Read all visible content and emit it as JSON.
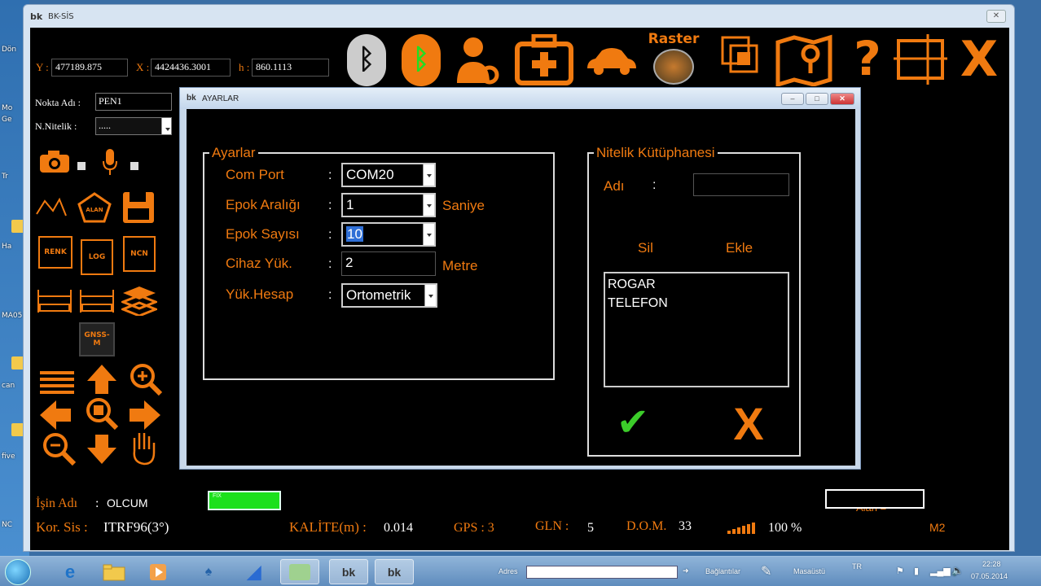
{
  "desktop": {
    "labels": [
      "Dön",
      "Mo",
      "Ge",
      "Tr",
      "Ha",
      "MA05",
      "can",
      "five",
      "NC"
    ]
  },
  "app": {
    "title": "BK-SİS",
    "close_glyph": "✕",
    "coords": {
      "y_label": "Y :",
      "y_value": "477189.875",
      "x_label": "X :",
      "x_value": "4424436.3001",
      "h_label": "h :",
      "h_value": "860.1113"
    },
    "toolbar": {
      "raster_label": "Raster",
      "help_glyph": "?",
      "exit_glyph": "X"
    },
    "left": {
      "nokta_label": "Nokta Adı :",
      "nokta_value": "PEN1",
      "nitelik_label": "N.Nitelik :",
      "nitelik_value": ".....",
      "renk_label": "RENK",
      "log_label": "LOG",
      "ncn_label": "NCN",
      "gnss_label": "GNSS-M",
      "alan_label": "ALAN"
    },
    "status": {
      "isin_label": "İşin Adı",
      "isin_colon": ":",
      "isin_value": "OLCUM",
      "kor_label": "Kor. Sis :",
      "kor_value": "ITRF96(3°)",
      "fix_text": "FIX",
      "kalite_label": "KALİTE(m) :",
      "kalite_value": "0.014",
      "gps_label": "GPS : 3",
      "gln_label": "GLN :",
      "gln_value": "5",
      "dom_label": "D.O.M.",
      "dom_value": "33",
      "signal_percent": "100 %",
      "alan_label": "Alan =",
      "m2_label": "M2"
    }
  },
  "dialog": {
    "title": "AYARLAR",
    "min_glyph": "–",
    "max_glyph": "□",
    "close_glyph": "✕",
    "ayarlar": {
      "title": "Ayarlar",
      "com_port_label": "Com Port",
      "com_port_value": "COM20",
      "epok_araligi_label": "Epok Aralığı",
      "epok_araligi_value": "1",
      "epok_araligi_unit": "Saniye",
      "epok_sayisi_label": "Epok Sayısı",
      "epok_sayisi_value": "10",
      "cihaz_yuk_label": "Cihaz Yük.",
      "cihaz_yuk_value": "2",
      "cihaz_yuk_unit": "Metre",
      "yuk_hesap_label": "Yük.Hesap",
      "yuk_hesap_value": "Ortometrik",
      "colon": ":"
    },
    "nitelik": {
      "title": "Nitelik Kütüphanesi",
      "adi_label": "Adı",
      "adi_colon": ":",
      "adi_value": "",
      "sil_label": "Sil",
      "ekle_label": "Ekle",
      "items": [
        "ROGAR",
        "TELEFON"
      ],
      "ok_glyph": "✔",
      "cancel_glyph": "X"
    }
  },
  "taskbar": {
    "adres_label": "Adres",
    "baglantilar_label": "Bağlantılar",
    "masaustu_label": "Masaüstü",
    "lang": "TR",
    "time": "22:28",
    "date": "07.05.2014",
    "bk_label": "bk"
  },
  "colors": {
    "accent_orange": "#f07a10",
    "fix_green": "#1ce01c",
    "ok_green": "#3ccc2a",
    "bluetooth_off": "#888888"
  }
}
